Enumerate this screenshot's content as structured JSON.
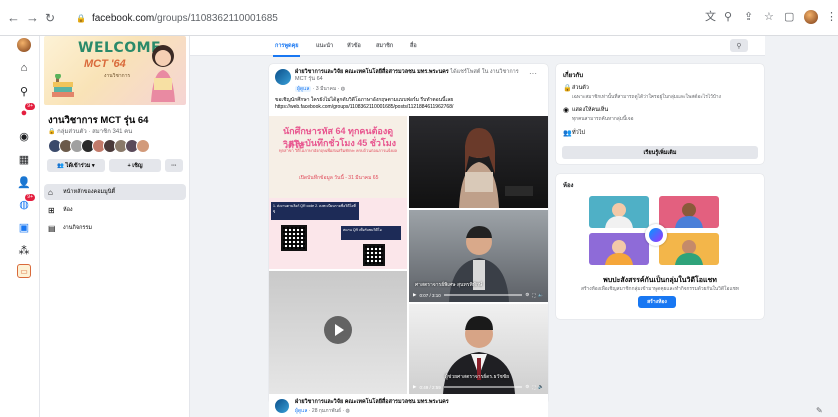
{
  "browser": {
    "url_host": "facebook.com",
    "url_path": "/groups/1108362110001685",
    "colors": {
      "accent": "#1877f2"
    }
  },
  "left_rail": {
    "badges": [
      "9+",
      "9+"
    ]
  },
  "group": {
    "cover_title": "WELCOME",
    "cover_subtitle": "MCT '64",
    "cover_caption": "งานวิชาการ",
    "name": "งานวิชาการ MCT รุ่น 64",
    "meta": "กลุ่มส่วนตัว · สมาชิก 341 คน",
    "joined_label": "ได้เข้าร่วม",
    "invite_label": "+ เชิญ",
    "more_label": "···",
    "menu": [
      {
        "label": "หน้าหลักของคอมมูนิตี้",
        "icon": "home-icon"
      },
      {
        "label": "ห้อง",
        "icon": "room-icon"
      },
      {
        "label": "งานกิจกรรม",
        "icon": "calendar-icon"
      }
    ]
  },
  "tabs": [
    "การพูดคุย",
    "แนะนำ",
    "หัวข้อ",
    "สมาชิก",
    "สื่อ"
  ],
  "post": {
    "author": "ฝ่ายวิชาการและวิจัย คณะเทคโนโลยีสื่อสารมวลชน มทร.พระนคร",
    "author_suffix": "ได้แชร์โพสต์ ใน งานวิชาการ MCT รุ่น 64",
    "role_tag": "ผู้ดูแล",
    "time": "3 มีนาคม",
    "text": "ขอเชิญนักศึกษา ใครยังไม่ได้ลูกดับวิดีโอภาษาอังกฤษตามแบบฟอร์ม รีบทำตอนนี้เลย",
    "link": "https://web.facebook.com/groups/1108362110001685/posts/1121884611962768/",
    "poster_line1": "นักศึกษารหัส 64 ทุกคนต้องดูวิดีโอ",
    "poster_line2": "และบันทึกชั่วโมง 45 ชั่วโมง",
    "poster_small": "ทุกสาขา วิดีโอภาษาอังกฤษเพื่อส่งเสริมทักษะ ครบถ้วนก่อนการแจ้งผล",
    "poster_deadline": "เปิดบันทึกข้อมูล วันนี้ - 31 มีนาคม 65",
    "poster_box1": "1. ส่งงานตามลิงก์ QR code 2. ลงทะเบียนรายชื่อวิดีโอที่ดู",
    "poster_box2": "สแกน QR เพื่อรับชมวิดีโอ",
    "video_caption": "ศาสตราจารย์พิเศษ สุนทรพิทักษ์",
    "video_time_1": "0:07 / 3:10",
    "video_time_2": "0:49 / 2:59",
    "video_caption_2": "ผู้ช่วยศาสตราจารย์ดร.ธวัชชัย"
  },
  "post2": {
    "author": "ฝ่ายวิชาการและวิจัย คณะเทคโนโลยีสื่อสารมวลชน มทร.พระนคร",
    "role_tag": "ผู้ดูแล",
    "time": "28 กุมภาพันธ์"
  },
  "about": {
    "title": "เกี่ยวกับ",
    "private_title": "ส่วนตัว",
    "private_sub": "เฉพาะสมาชิกเท่านั้นที่สามารถดูได้ว่าใครอยู่ในกลุ่มและโพสต์อะไรไว้บ้าง",
    "visible_title": "แสดงให้คนเห็น",
    "visible_sub": "ทุกคนสามารถค้นหากลุ่มนี้เจอ",
    "general": "ทั่วไป",
    "more_button": "เรียนรู้เพิ่มเติม"
  },
  "rooms": {
    "title": "ห้อง",
    "heading": "พบปะสังสรรค์กันเป็นกลุ่มในวิดีโอแชท",
    "sub": "สร้างห้องเพื่อเชิญสมาชิกกลุ่มเข้ามาพูดคุยและทำกิจกรรมด้วยกันในวิดีโอแชท",
    "button": "สร้างห้อง"
  }
}
